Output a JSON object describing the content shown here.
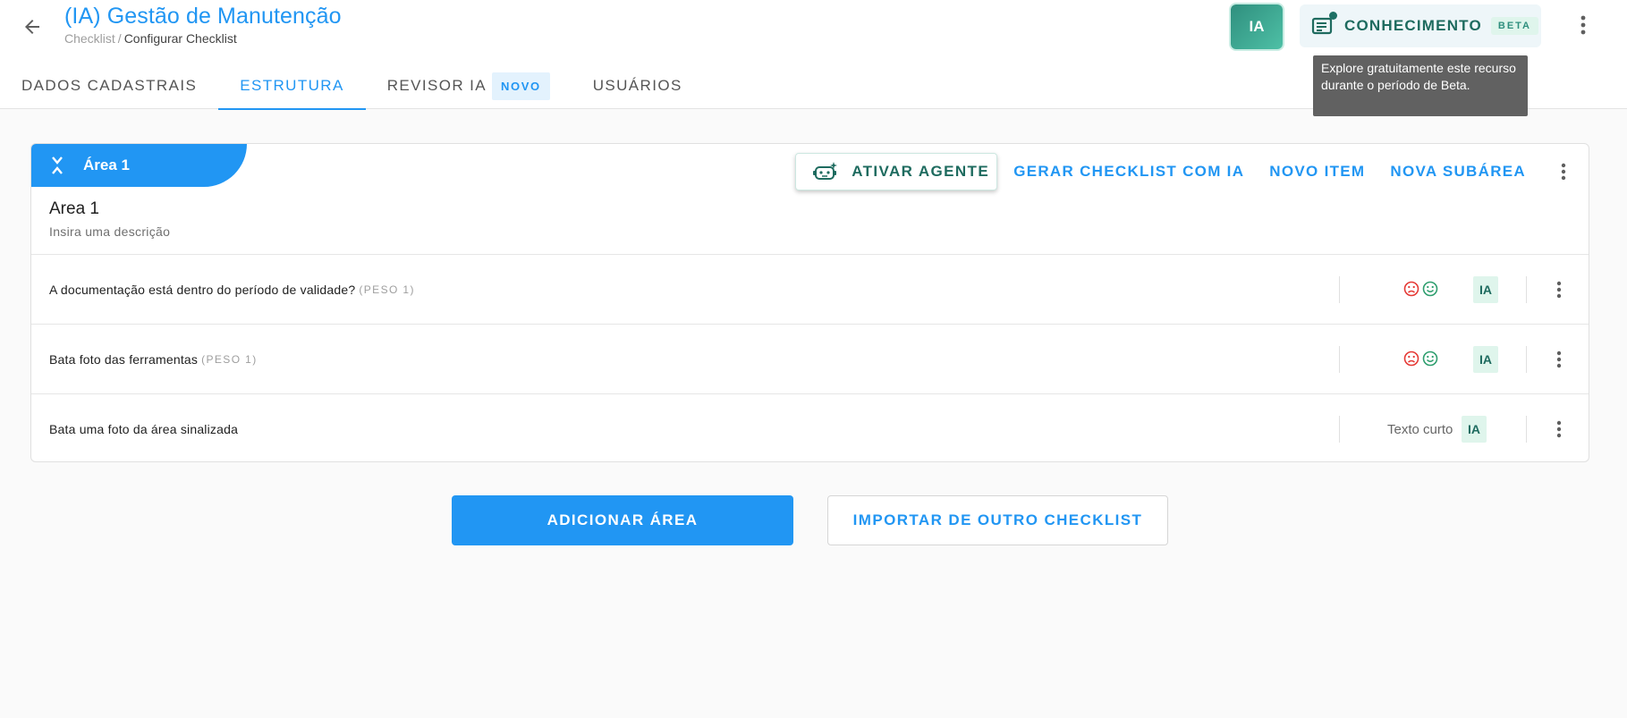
{
  "header": {
    "title": "(IA) Gestão de Manutenção",
    "breadcrumb": {
      "root": "Checklist",
      "separator": "/",
      "current": "Configurar Checklist"
    },
    "ia_avatar_label": "IA",
    "knowledge": {
      "label": "CONHECIMENTO",
      "badge": "BETA"
    },
    "tooltip": "Explore gratuitamente este recurso durante o período de Beta."
  },
  "tabs": [
    {
      "label": "DADOS CADASTRAIS",
      "active": false
    },
    {
      "label": "ESTRUTURA",
      "active": true
    },
    {
      "label": "REVISOR IA",
      "badge": "NOVO",
      "active": false
    },
    {
      "label": "USUÁRIOS",
      "active": false
    }
  ],
  "area": {
    "tag_label": "Área 1",
    "name": "Area 1",
    "description_placeholder": "Insira uma descrição",
    "actions": {
      "activate_agent": "ATIVAR AGENTE",
      "generate_with_ai": "GERAR CHECKLIST COM IA",
      "new_item": "NOVO ITEM",
      "new_subarea": "NOVA SUBÁREA"
    },
    "items": [
      {
        "question": "A documentação está dentro do período de validade?",
        "weight": "(PESO 1)",
        "answer_type": "",
        "ia_label": "IA"
      },
      {
        "question": "Bata foto das ferramentas",
        "weight": "(PESO 1)",
        "answer_type": "",
        "ia_label": "IA"
      },
      {
        "question": "Bata uma foto da área sinalizada",
        "weight": "",
        "answer_type": "Texto curto",
        "ia_label": "IA"
      }
    ]
  },
  "footer": {
    "add_area": "ADICIONAR ÁREA",
    "import_checklist": "IMPORTAR DE OUTRO CHECKLIST"
  },
  "colors": {
    "primary": "#2196f3",
    "ia_green": "#1e6b5f",
    "sad_face": "#e53935",
    "happy_face": "#2e9e6e",
    "tooltip_bg": "#616161"
  },
  "icons": {
    "back": "arrow-left-icon",
    "knowledge": "document-notification-icon",
    "overflow": "vertical-dots-icon",
    "collapse": "collapse-chevrons-icon",
    "agent": "robot-icon",
    "negative": "sad-face-icon",
    "positive": "happy-face-icon"
  }
}
